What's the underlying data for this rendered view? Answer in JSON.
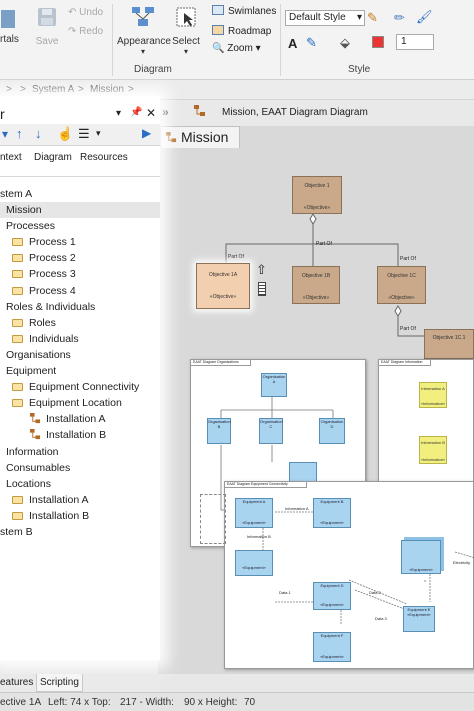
{
  "ribbon": {
    "portals_label": "rtals",
    "save_label": "Save",
    "undo_label": "Undo",
    "redo_label": "Redo",
    "appearance_label": "Appearance",
    "select_label": "Select",
    "swimlanes_label": "Swimlanes",
    "roadmap_label": "Roadmap",
    "zoom_label": "Zoom",
    "style_select_value": "Default Style",
    "spin_value": "1",
    "group_diagram": "Diagram",
    "group_style": "Style"
  },
  "breadcrumb": {
    "item1": "System A",
    "item2": "Mission",
    "sep": ">"
  },
  "tab": {
    "header_text": "Mission,  EAAT Diagram Diagram",
    "title": "Mission"
  },
  "browser": {
    "title": "r",
    "tabs": [
      "ntext",
      "Diagram",
      "Resources"
    ],
    "items": [
      {
        "label": "stem A",
        "indent": 0,
        "icon": "none"
      },
      {
        "label": "Mission",
        "indent": 1,
        "icon": "none"
      },
      {
        "label": "Processes",
        "indent": 1,
        "icon": "none"
      },
      {
        "label": "Process 1",
        "indent": 2,
        "icon": "folder"
      },
      {
        "label": "Process 2",
        "indent": 2,
        "icon": "folder"
      },
      {
        "label": "Process 3",
        "indent": 2,
        "icon": "folder"
      },
      {
        "label": "Process 4",
        "indent": 2,
        "icon": "folder"
      },
      {
        "label": "Roles & Individuals",
        "indent": 1,
        "icon": "none"
      },
      {
        "label": "Roles",
        "indent": 2,
        "icon": "folder"
      },
      {
        "label": "Individuals",
        "indent": 2,
        "icon": "folder"
      },
      {
        "label": "Organisations",
        "indent": 1,
        "icon": "none"
      },
      {
        "label": "Equipment",
        "indent": 1,
        "icon": "none"
      },
      {
        "label": "Equipment Connectivity",
        "indent": 2,
        "icon": "folder"
      },
      {
        "label": "Equipment Location",
        "indent": 2,
        "icon": "folder"
      },
      {
        "label": "Installation A",
        "indent": 3,
        "icon": "package"
      },
      {
        "label": "Installation B",
        "indent": 3,
        "icon": "package"
      },
      {
        "label": "Information",
        "indent": 1,
        "icon": "none"
      },
      {
        "label": "Consumables",
        "indent": 1,
        "icon": "none"
      },
      {
        "label": "Locations",
        "indent": 1,
        "icon": "none"
      },
      {
        "label": "Installation A",
        "indent": 2,
        "icon": "folder"
      },
      {
        "label": "Installation B",
        "indent": 2,
        "icon": "folder"
      },
      {
        "label": "stem B",
        "indent": 0,
        "icon": "none"
      }
    ],
    "selected_index": 1
  },
  "bottom_tabs": [
    "eatures",
    "Scripting"
  ],
  "status": {
    "element": "ective 1A",
    "left": "Left:   74 x Top:",
    "top": "217 - Width:",
    "width": "90 x Height:",
    "height": "70"
  },
  "diagram": {
    "objective_1": "Objective 1",
    "objective_1a": "Objective 1A",
    "objective_1b": "Objective 1B",
    "objective_1c": "Objective 1C",
    "objective_1c1": "Objective 1C.1",
    "stereotype": "«Objective»",
    "part_of": "Part Of",
    "org_title": "EAAT Diagram Organisations",
    "info_title": "EAAT Diagram Information",
    "conn_title": "EAAT Diagram Equipment Connectivity",
    "info_a": "Information A",
    "info_b": "Information B",
    "info_st": "«Information»",
    "org_a": "Organisation A",
    "org_b": "Organisation B",
    "org_c": "Organisation C",
    "org_d": "Organisation D",
    "eq_a": "Equipment A",
    "eq_b": "Equipment B",
    "eq_c": "Equipment C",
    "eq_d": "Equipment D",
    "eq_e": "Equipment E",
    "eq_f": "Equipment F",
    "eq_st": "«Equipment»",
    "info_a_flow": "Information A",
    "info_b_flow": "Information B",
    "data_1": "Data 1",
    "data_2": "Data 2",
    "data_3": "Data 3",
    "electricity": "Electricity",
    "part_of2": "Part Of",
    "owned": "Part Of"
  },
  "colors": {
    "objective_fill": "#c9a98a",
    "selected_fill": "#f2cfae",
    "equipment_fill": "#a8d4f0",
    "info_fill": "#f2ef7e",
    "accent_blue": "#2b6cc4"
  }
}
